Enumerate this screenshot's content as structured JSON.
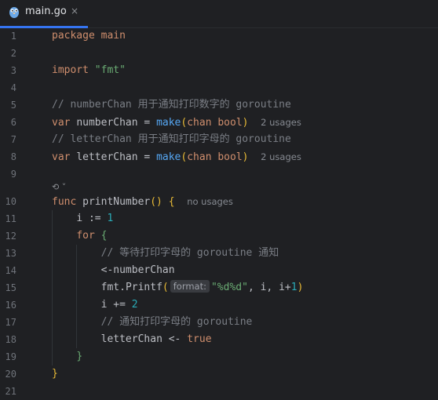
{
  "tab": {
    "label": "main.go",
    "close": "×",
    "icon": "gopher-icon"
  },
  "line_numbers": [
    "1",
    "2",
    "3",
    "4",
    "5",
    "6",
    "7",
    "8",
    "9",
    "10",
    "11",
    "12",
    "13",
    "14",
    "15",
    "16",
    "17",
    "18",
    "19",
    "20",
    "21"
  ],
  "code": {
    "l1_kw": "package",
    "l1_name": "main",
    "l3_kw": "import",
    "l3_str": "\"fmt\"",
    "l5_comment": "// numberChan 用于通知打印数字的 goroutine",
    "l6_kw": "var",
    "l6_name": "numberChan",
    "l6_eq": "=",
    "l6_make": "make",
    "l6_open": "(",
    "l6_chan": "chan",
    "l6_bool": "bool",
    "l6_close": ")",
    "l6_usages": "2 usages",
    "l7_comment": "// letterChan 用于通知打印字母的 goroutine",
    "l8_kw": "var",
    "l8_name": "letterChan",
    "l8_eq": "=",
    "l8_make": "make",
    "l8_open": "(",
    "l8_chan": "chan",
    "l8_bool": "bool",
    "l8_close": ")",
    "l8_usages": "2 usages",
    "l9_fold": "⟲ ˅",
    "l10_kw": "func",
    "l10_name": "printNumber",
    "l10_parens": "()",
    "l10_brace": "{",
    "l10_usages": "no usages",
    "l11_var": "i",
    "l11_op": ":=",
    "l11_num": "1",
    "l12_kw": "for",
    "l12_brace": "{",
    "l13_comment": "// 等待打印字母的 goroutine 通知",
    "l14_code": "<-numberChan",
    "l15_pkg": "fmt",
    "l15_dot": ".",
    "l15_fn": "Printf",
    "l15_open": "(",
    "l15_hint": "format:",
    "l15_str": "\"%d%d\"",
    "l15_rest1": ", i, i+",
    "l15_num": "1",
    "l15_close": ")",
    "l16_var": "i",
    "l16_op": "+=",
    "l16_num": "2",
    "l17_comment": "// 通知打印字母的 goroutine",
    "l18_var": "letterChan",
    "l18_op": "<-",
    "l18_kw": "true",
    "l19_brace": "}",
    "l20_brace": "}"
  },
  "colors": {
    "background": "#1f2023",
    "keyword": "#cf8e6d",
    "string": "#6aab73",
    "comment": "#7a7e85",
    "function": "#56a8f5",
    "number": "#2aacb8",
    "accent": "#3574f0"
  }
}
